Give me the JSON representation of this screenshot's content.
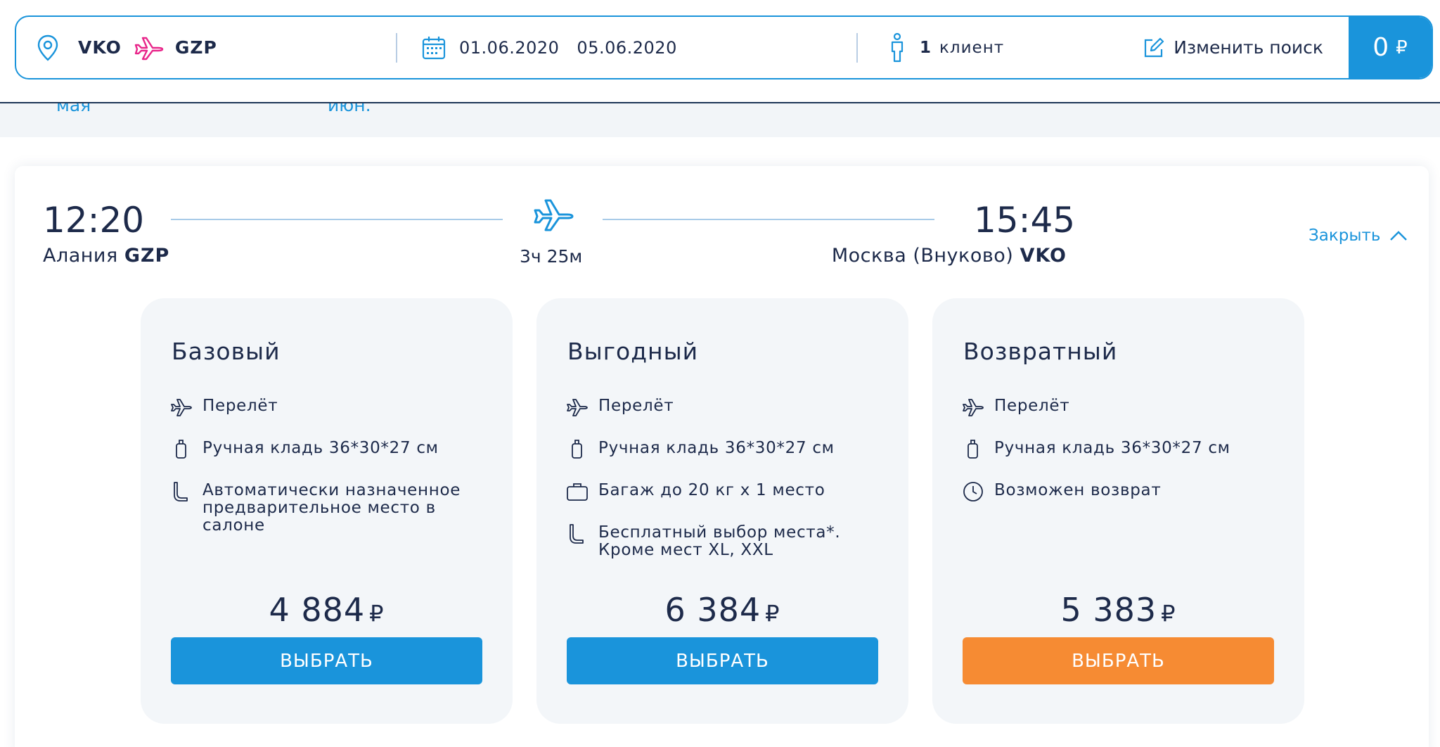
{
  "search": {
    "from_code": "VKO",
    "to_code": "GZP",
    "date_from": "01.06.2020",
    "date_to": "05.06.2020",
    "clients_count": "1",
    "clients_label": "клиент",
    "change_label": "Изменить поиск",
    "total_value": "0",
    "currency": "₽"
  },
  "calendar_strip": {
    "label_left": "мая",
    "label_right": "июн."
  },
  "flight": {
    "departure_time": "12:20",
    "departure_city": "Алания",
    "departure_code": "GZP",
    "duration": "3ч 25м",
    "arrival_time": "15:45",
    "arrival_city": "Москва (Внуково)",
    "arrival_code": "VKO",
    "close_label": "Закрыть"
  },
  "tariffs": [
    {
      "title": "Базовый",
      "features": [
        {
          "icon": "plane-icon",
          "text": "Перелёт"
        },
        {
          "icon": "hand-luggage-icon",
          "text": "Ручная кладь 36*30*27 см"
        },
        {
          "icon": "seat-icon",
          "text": "Автоматически назначенное предварительное место в салоне"
        }
      ],
      "price": "4 884",
      "button_label": "ВЫБРАТЬ",
      "button_color": "#1a94db"
    },
    {
      "title": "Выгодный",
      "features": [
        {
          "icon": "plane-icon",
          "text": "Перелёт"
        },
        {
          "icon": "hand-luggage-icon",
          "text": "Ручная кладь 36*30*27 см"
        },
        {
          "icon": "suitcase-icon",
          "text": "Багаж до 20 кг х 1 место"
        },
        {
          "icon": "seat-icon",
          "text": "Бесплатный выбор места*. Кроме мест XL, XXL"
        }
      ],
      "price": "6 384",
      "button_label": "ВЫБРАТЬ",
      "button_color": "#1a94db"
    },
    {
      "title": "Возвратный",
      "features": [
        {
          "icon": "plane-icon",
          "text": "Перелёт"
        },
        {
          "icon": "hand-luggage-icon",
          "text": "Ручная кладь 36*30*27 см"
        },
        {
          "icon": "clock-icon",
          "text": "Возможен возврат"
        }
      ],
      "price": "5 383",
      "button_label": "ВЫБРАТЬ",
      "button_color": "#f68b33"
    }
  ],
  "colors": {
    "accent_blue": "#1a94db",
    "accent_orange": "#f68b33",
    "accent_pink": "#e8268a",
    "text_dark": "#1d2a4a"
  }
}
